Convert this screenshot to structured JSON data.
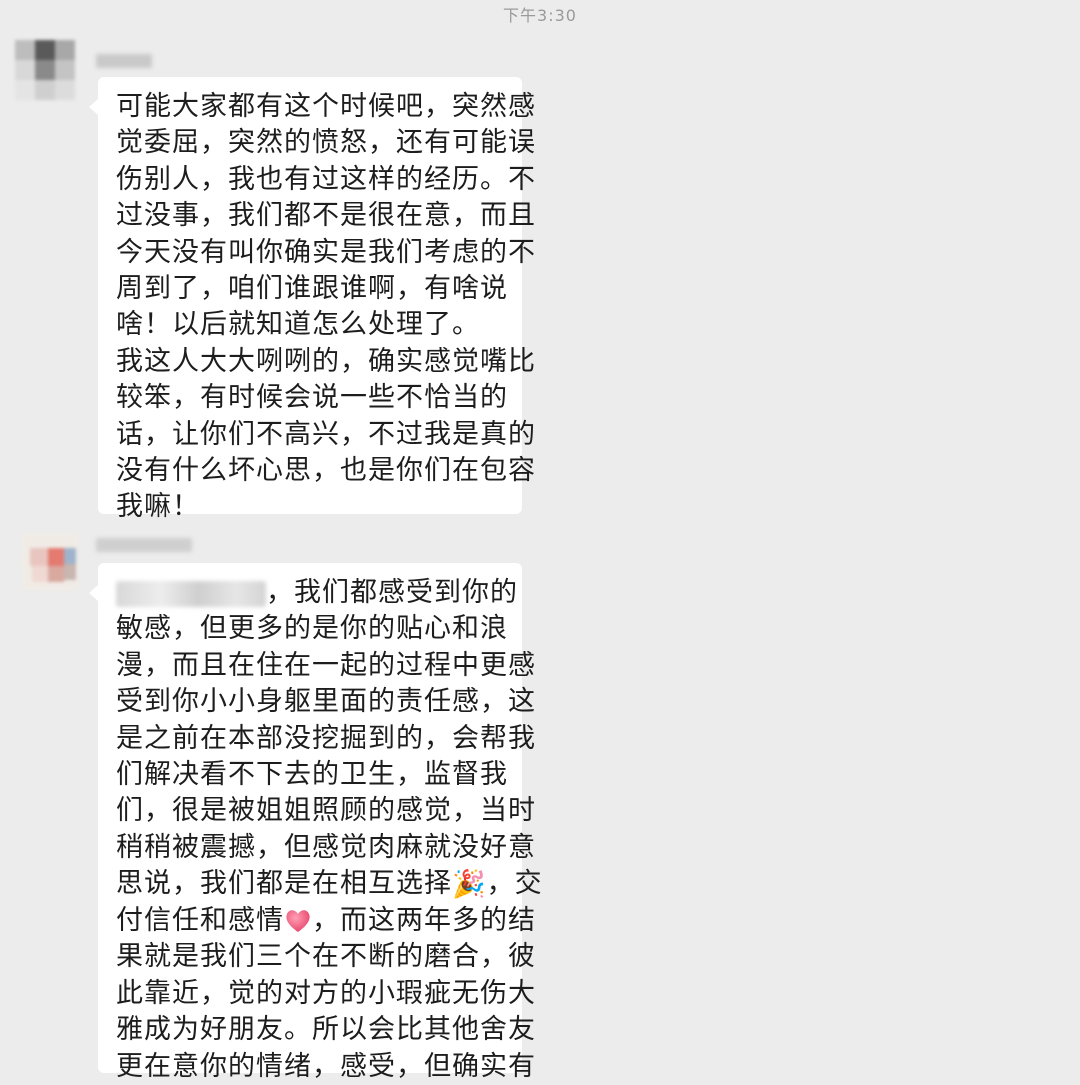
{
  "chat": {
    "timestamp": "下午3:30",
    "messages": [
      {
        "sender_name": "",
        "lines": [
          "可能大家都有这个时候吧，突然感",
          "觉委屈，突然的愤怒，还有可能误",
          "伤别人，我也有过这样的经历。不",
          "过没事，我们都不是很在意，而且",
          "今天没有叫你确实是我们考虑的不",
          "周到了，咱们谁跟谁啊，有啥说",
          "啥！以后就知道怎么处理了。",
          "我这人大大咧咧的，确实感觉嘴比",
          "较笨，有时候会说一些不恰当的",
          "话，让你们不高兴，不过我是真的",
          "没有什么坏心思，也是你们在包容",
          "我嘛！"
        ]
      },
      {
        "sender_name": "",
        "line1_tail": "，我们都感受到你的",
        "lines": [
          "敏感，但更多的是你的贴心和浪",
          "漫，而且在住在一起的过程中更感",
          "受到你小小身躯里面的责任感，这",
          "是之前在本部没挖掘到的，会帮我",
          "们解决看不下去的卫生，监督我",
          "们，很是被姐姐照顾的感觉，当时",
          "稍稍被震撼，但感觉肉麻就没好意"
        ],
        "line9_text": "思说，我们都是在相互选择",
        "line9_emoji": "🎉",
        "line9_tail": "，交",
        "line10_text": "付信任和感情",
        "line10_tail": "，而这两年多的结",
        "lines_after": [
          "果就是我们三个在不断的磨合，彼",
          "此靠近，觉的对方的小瑕疵无伤大",
          "雅成为好朋友。所以会比其他舍友",
          "更在意你的情绪，感受，但确实有"
        ]
      }
    ]
  }
}
